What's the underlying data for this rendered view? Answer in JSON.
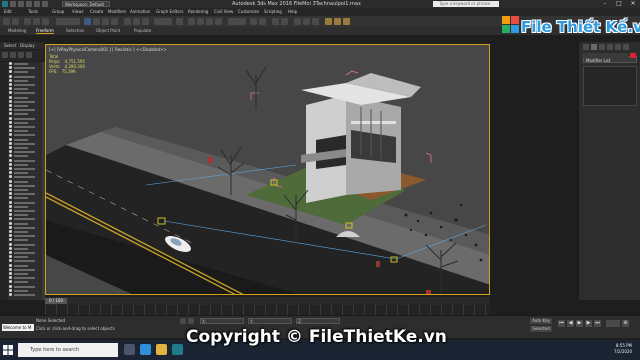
{
  "window": {
    "workspace": "Workspace: Default",
    "title": "Autodesk 3ds Max 2016   FileMoi 3Tachnaulpoi1.max",
    "search_placeholder": "Type a keyword or phrase",
    "minimize": "–",
    "maximize": "□",
    "close": "✕"
  },
  "menu": [
    "Edit",
    "Tools",
    "Group",
    "Views",
    "Create",
    "Modifiers",
    "Animation",
    "Graph Editors",
    "Rendering",
    "Civil View",
    "Customize",
    "Scripting",
    "Help"
  ],
  "ribbon_tabs": [
    "Modeling",
    "Freeform",
    "Selection",
    "Object Paint",
    "Populate"
  ],
  "ribbon_active_index": 1,
  "scene_explorer": {
    "tabs": [
      "Select",
      "Display"
    ],
    "row_count": 56
  },
  "viewport": {
    "label": "[+] [VRayPhysicalCamera001 ] [ Realistic ] <<Disabled>>",
    "stats": [
      {
        "label": "Total",
        "value": ""
      },
      {
        "label": "Polys:",
        "value": "4,751,595"
      },
      {
        "label": "Verts:",
        "value": "4,390,306"
      },
      {
        "label": "FPS:",
        "value": "75,399"
      }
    ]
  },
  "command_panel": {
    "modifier_list": "Modifier List",
    "object_color": "#dd2233"
  },
  "timeline": {
    "slider": "0 / 100"
  },
  "status": {
    "maxscript": "Welcome to M",
    "selection": "None Selected",
    "prompt": "Click or click-and-drag to select objects",
    "x": "X:",
    "y": "Y:",
    "z": "Z:",
    "autokey": "Auto Key",
    "selected": "Selected"
  },
  "taskbar": {
    "search_placeholder": "Type here to search",
    "time": "8:55 PM",
    "date": "7/2/2020"
  },
  "watermark": {
    "logo": "File Thiết Kế.vn",
    "copyright": "Copyright © FileThietKe.vn"
  },
  "colors": {
    "accent": "#d4a017",
    "viewport_bg": "#4a4a4a",
    "brand": "#2e9be0"
  }
}
